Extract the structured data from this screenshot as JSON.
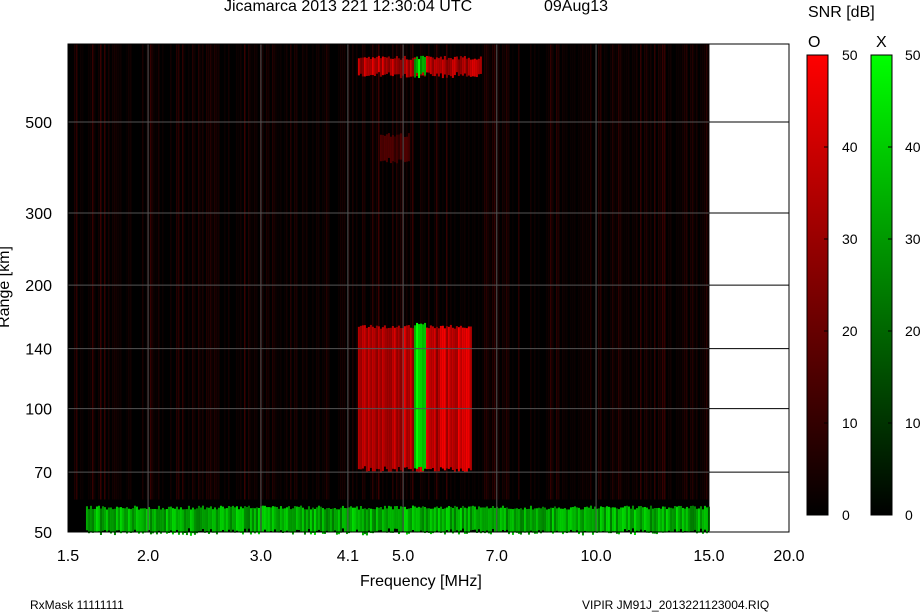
{
  "header": {
    "title": "Jicamarca 2013 221 12:30:04 UTC",
    "date": "09Aug13"
  },
  "footer": {
    "rxmask": "RxMask 11111111",
    "file": "VIPIR  JM91J_2013221123004.RIQ"
  },
  "colorbar": {
    "title": "SNR [dB]",
    "o_label": "O",
    "x_label": "X",
    "ticks": [
      "50",
      "40",
      "30",
      "20",
      "10",
      "0"
    ],
    "range": [
      0,
      50
    ],
    "o_color": "#ff0000",
    "x_color": "#00ff00"
  },
  "chart_data": {
    "type": "heatmap",
    "title": "Jicamarca 2013 221 12:30:04 UTC 09Aug13",
    "xlabel": "Frequency [MHz]",
    "ylabel": "Range [km]",
    "xscale": "log",
    "yscale": "log",
    "xlim": [
      1.5,
      20.0
    ],
    "ylim": [
      50,
      775
    ],
    "data_xmax": 15.0,
    "xticks": [
      1.5,
      2.0,
      3.0,
      4.1,
      5.0,
      7.0,
      10.0,
      15.0,
      20.0
    ],
    "xtick_labels": [
      "1.5",
      "2.0",
      "3.0",
      "4.1",
      "5.0",
      "7.0",
      "10.0",
      "15.0",
      "20.0"
    ],
    "yticks": [
      50,
      70,
      100,
      140,
      200,
      300,
      500
    ],
    "ytick_labels": [
      "50",
      "70",
      "100",
      "140",
      "200",
      "300",
      "500"
    ],
    "grid": true,
    "echoes": [
      {
        "name": "o-mode-f-layer",
        "mode": "O",
        "f_min": 4.25,
        "f_max": 6.4,
        "range_min": 71,
        "range_max": 160,
        "snr_db": 45
      },
      {
        "name": "x-mode-f-layer",
        "mode": "X",
        "f_min": 5.2,
        "f_max": 5.4,
        "range_min": 71,
        "range_max": 162,
        "snr_db": 48
      },
      {
        "name": "o-mode-multihop",
        "mode": "O",
        "f_min": 4.25,
        "f_max": 6.6,
        "range_min": 650,
        "range_max": 725,
        "snr_db": 42
      },
      {
        "name": "x-mode-multihop",
        "mode": "X",
        "f_min": 5.2,
        "f_max": 5.4,
        "range_min": 650,
        "range_max": 728,
        "snr_db": 45
      },
      {
        "name": "o-mode-faint",
        "mode": "O",
        "f_min": 4.6,
        "f_max": 5.1,
        "range_min": 400,
        "range_max": 470,
        "snr_db": 15
      },
      {
        "name": "x-mode-low-band",
        "mode": "X",
        "f_min": 1.6,
        "f_max": 15.0,
        "range_min": 50,
        "range_max": 58,
        "snr_db": 40
      }
    ]
  }
}
